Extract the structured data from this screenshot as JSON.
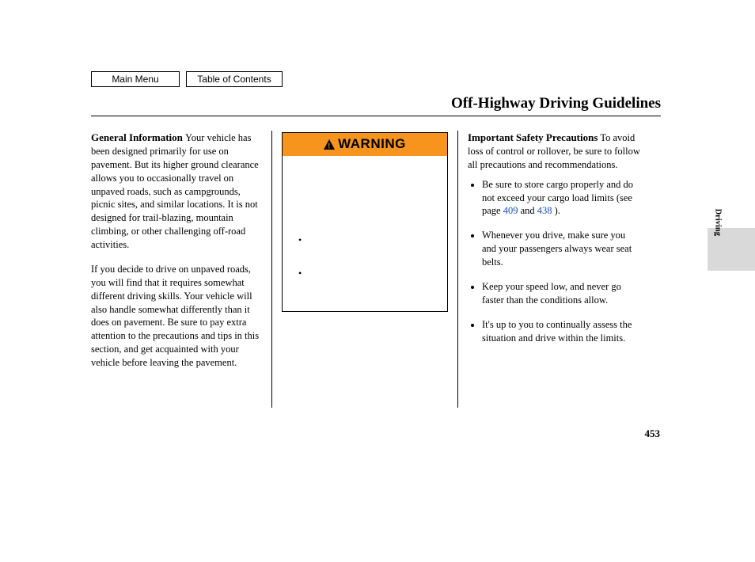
{
  "nav": {
    "main_menu": "Main Menu",
    "toc": "Table of Contents"
  },
  "title": "Off-Highway Driving Guidelines",
  "col1": {
    "heading": "General Information",
    "para1": "Your vehicle has been designed primarily for use on pavement. But its higher ground clearance allows you to occasionally travel on unpaved roads, such as campgrounds, picnic sites, and similar locations. It is not designed for trail-blazing, mountain climbing, or other challenging off-road activities.",
    "para2": "If you decide to drive on unpaved roads, you will find that it requires somewhat different driving skills. Your vehicle will also handle somewhat differently than it does on pavement. Be sure to pay extra attention to the precautions and tips in this section, and get acquainted with your vehicle before leaving the pavement."
  },
  "warning": {
    "label": "WARNING",
    "bullet1": "",
    "bullet2": ""
  },
  "col3": {
    "heading": "Important Safety Precautions",
    "intro": "To avoid loss of control or rollover, be sure to follow all precautions and recommendations.",
    "items": [
      {
        "pre": "Be sure to store cargo properly and do not exceed your cargo load limits (see page ",
        "ref1": "409",
        "mid": " and ",
        "ref2": "438",
        "post": " )."
      },
      {
        "text": "Whenever you drive, make sure you and your passengers always wear seat belts."
      },
      {
        "text": "Keep your speed low, and never go faster than the conditions allow."
      },
      {
        "text": "It's up to you to continually assess the situation and drive within the limits."
      }
    ]
  },
  "section_tab": "Driving",
  "page_number": "453"
}
